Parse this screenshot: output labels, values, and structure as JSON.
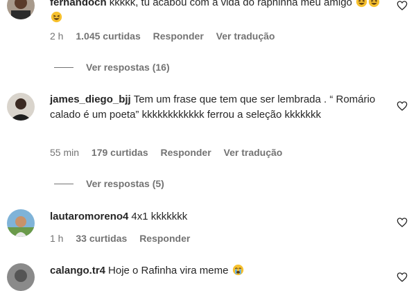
{
  "comments": [
    {
      "username": "fernandoch",
      "text": "kkkkk, tu acabou com a vida do raphinha meu amigo",
      "emojis": [
        "grinning-squint-face",
        "grinning-squint-face",
        "grinning-squint-face"
      ],
      "time": "2 h",
      "likes": "1.045 curtidas",
      "reply_label": "Responder",
      "translate_label": "Ver tradução",
      "view_replies": "Ver respostas (16)"
    },
    {
      "username": "james_diego_bjj",
      "text": "Tem um frase que tem que ser lembrada . “ Romário calado é um poeta” kkkkkkkkkkkk ferrou a seleção kkkkkkk",
      "time": "55 min",
      "likes": "179 curtidas",
      "reply_label": "Responder",
      "translate_label": "Ver tradução",
      "view_replies": "Ver respostas (5)"
    },
    {
      "username": "lautaromoreno4",
      "text": "4x1 kkkkkkk",
      "time": "1 h",
      "likes": "33 curtidas",
      "reply_label": "Responder"
    },
    {
      "username": "calango.tr4",
      "text": "Hoje o Rafinha vira meme",
      "emojis": [
        "loudly-crying-face"
      ]
    }
  ],
  "icons": {
    "like": "heart-outline-icon"
  },
  "colors": {
    "text": "#262626",
    "secondary": "#737373",
    "emoji": "#f7c12e"
  }
}
